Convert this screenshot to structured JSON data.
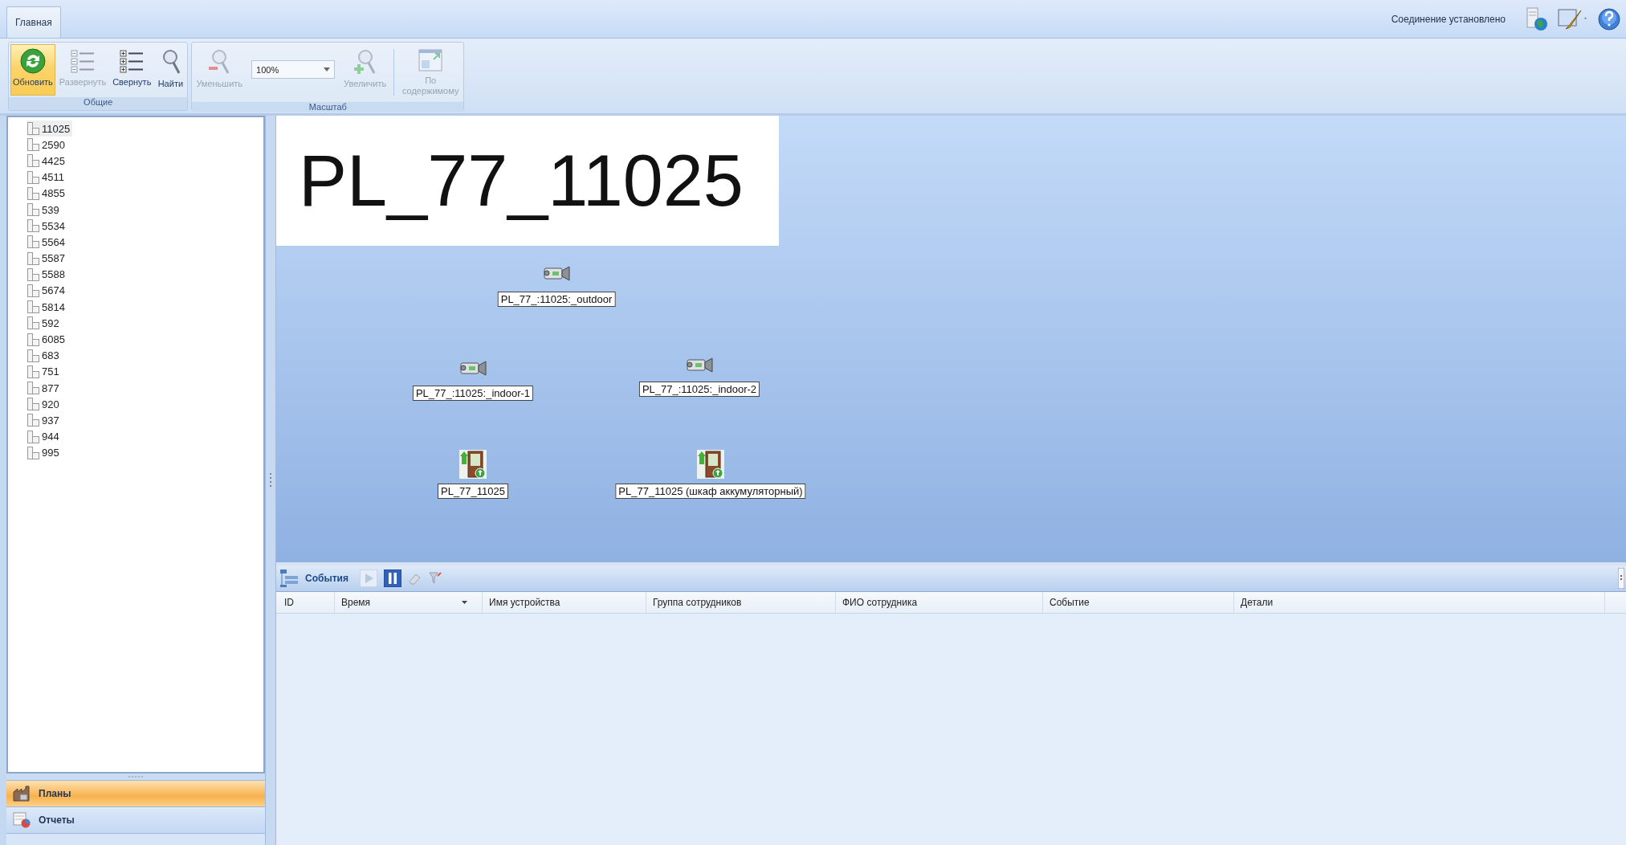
{
  "tabs": [
    {
      "label": "Главная",
      "selected": true
    }
  ],
  "status": {
    "connection": "Соединение установлено"
  },
  "ribbon": {
    "groups": [
      {
        "title": "Общие",
        "buttons": [
          {
            "kind": "refresh",
            "label": "Обновить",
            "disabled": false,
            "active": true
          },
          {
            "kind": "expand",
            "label": "Развернуть",
            "disabled": true,
            "active": false
          },
          {
            "kind": "collapse",
            "label": "Свернуть",
            "disabled": false,
            "active": false
          },
          {
            "kind": "find",
            "label": "Найти",
            "disabled": false,
            "active": false
          }
        ]
      },
      {
        "title": "Масштаб",
        "buttons": [
          {
            "kind": "zoom-out",
            "label": "Уменьшить",
            "disabled": true,
            "active": false
          },
          {
            "kind": "combo",
            "value": "100%"
          },
          {
            "kind": "zoom-in",
            "label": "Увеличить",
            "disabled": true,
            "active": false
          },
          {
            "kind": "fit",
            "label": "По содержимому",
            "disabled": true,
            "active": false
          }
        ]
      }
    ]
  },
  "tree": {
    "items": [
      {
        "label": "11025",
        "selected": true
      },
      {
        "label": "2590",
        "selected": false
      },
      {
        "label": "4425",
        "selected": false
      },
      {
        "label": "4511",
        "selected": false
      },
      {
        "label": "4855",
        "selected": false
      },
      {
        "label": "539",
        "selected": false
      },
      {
        "label": "5534",
        "selected": false
      },
      {
        "label": "5564",
        "selected": false
      },
      {
        "label": "5587",
        "selected": false
      },
      {
        "label": "5588",
        "selected": false
      },
      {
        "label": "5674",
        "selected": false
      },
      {
        "label": "5814",
        "selected": false
      },
      {
        "label": "592",
        "selected": false
      },
      {
        "label": "6085",
        "selected": false
      },
      {
        "label": "683",
        "selected": false
      },
      {
        "label": "751",
        "selected": false
      },
      {
        "label": "877",
        "selected": false
      },
      {
        "label": "920",
        "selected": false
      },
      {
        "label": "937",
        "selected": false
      },
      {
        "label": "944",
        "selected": false
      },
      {
        "label": "995",
        "selected": false
      }
    ]
  },
  "nav": [
    {
      "kind": "plans",
      "label": "Планы",
      "selected": true
    },
    {
      "kind": "reports",
      "label": "Отчеты",
      "selected": false
    }
  ],
  "plan": {
    "title": "PL_77_11025",
    "devices": [
      {
        "kind": "camera",
        "label": "PL_77_:11025:_outdoor"
      },
      {
        "kind": "camera",
        "label": "PL_77_:11025:_indoor-1"
      },
      {
        "kind": "camera",
        "label": "PL_77_:11025:_indoor-2"
      },
      {
        "kind": "door",
        "label": "PL_77_11025"
      },
      {
        "kind": "door",
        "label": "PL_77_11025 (шкаф аккумуляторный)"
      }
    ]
  },
  "events": {
    "title": "События",
    "columns": [
      {
        "label": "ID",
        "menu": false
      },
      {
        "label": "Время",
        "menu": true
      },
      {
        "label": "Имя устройства",
        "menu": false
      },
      {
        "label": "Группа сотрудников",
        "menu": false
      },
      {
        "label": "ФИО сотрудника",
        "menu": false
      },
      {
        "label": "Событие",
        "menu": false
      },
      {
        "label": "Детали",
        "menu": false
      }
    ]
  }
}
